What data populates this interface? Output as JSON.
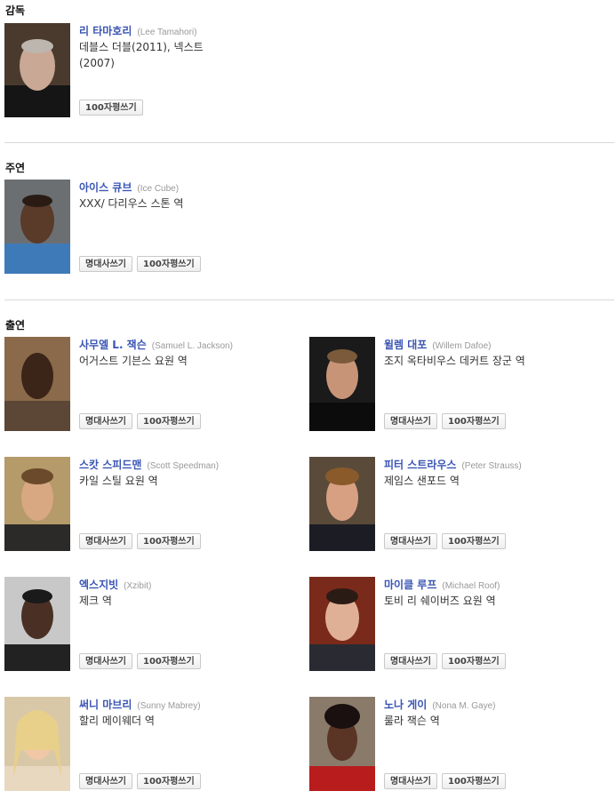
{
  "sections": {
    "director": "감독",
    "lead": "주연",
    "cast": "출연"
  },
  "buttons": {
    "quote": "명대사쓰기",
    "review": "100자평쓰기"
  },
  "director": {
    "name": "리 타마호리",
    "ename": "(Lee Tamahori)",
    "role": "데블스 더블(2011), 넥스트 (2007)"
  },
  "lead": {
    "name": "아이스 큐브",
    "ename": "(Ice Cube)",
    "role": "XXX/ 다리우스 스톤 역"
  },
  "cast": [
    {
      "name": "사무엘 L. 잭슨",
      "ename": "(Samuel L. Jackson)",
      "role": "어거스트 기븐스 요원 역"
    },
    {
      "name": "윌렘 대포",
      "ename": "(Willem Dafoe)",
      "role": "조지 옥타비우스 데커트 장군 역"
    },
    {
      "name": "스캇 스피드맨",
      "ename": "(Scott Speedman)",
      "role": "카일 스틸 요원 역"
    },
    {
      "name": "피터 스트라우스",
      "ename": "(Peter Strauss)",
      "role": "제임스 샌포드 역"
    },
    {
      "name": "엑스지빗",
      "ename": "(Xzibit)",
      "role": "제크 역"
    },
    {
      "name": "마이클 루프",
      "ename": "(Michael Roof)",
      "role": "토비 리 쉐이버즈 요원 역"
    },
    {
      "name": "써니 마브리",
      "ename": "(Sunny Mabrey)",
      "role": "할리 메이웨더 역"
    },
    {
      "name": "노나 게이",
      "ename": "(Nona M. Gaye)",
      "role": "룰라 잭슨 역"
    }
  ]
}
